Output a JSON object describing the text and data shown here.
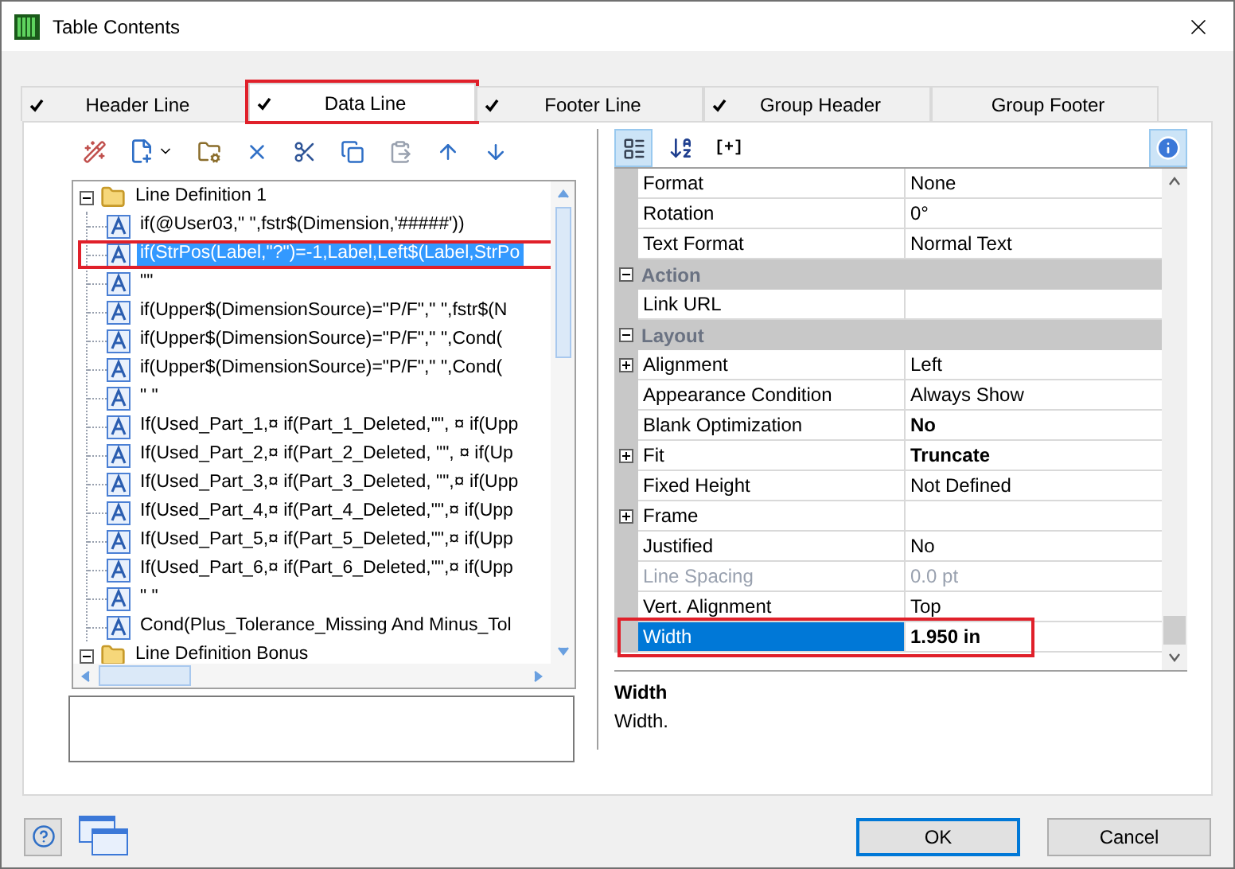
{
  "window": {
    "title": "Table Contents"
  },
  "tabs": [
    {
      "label": "Header Line",
      "checked": true,
      "selected": false,
      "highlighted": false
    },
    {
      "label": "Data Line",
      "checked": true,
      "selected": true,
      "highlighted": true
    },
    {
      "label": "Footer Line",
      "checked": true,
      "selected": false,
      "highlighted": false
    },
    {
      "label": "Group Header",
      "checked": true,
      "selected": false,
      "highlighted": false
    },
    {
      "label": "Group Footer",
      "checked": false,
      "selected": false,
      "highlighted": false
    }
  ],
  "left_toolbar": [
    {
      "kind": "wand",
      "disabled": false
    },
    {
      "kind": "new",
      "disabled": false
    },
    {
      "kind": "properties",
      "disabled": false
    },
    {
      "kind": "delete",
      "disabled": false
    },
    {
      "kind": "cut",
      "disabled": false
    },
    {
      "kind": "copy",
      "disabled": false
    },
    {
      "kind": "paste",
      "disabled": true
    },
    {
      "kind": "up",
      "disabled": false
    },
    {
      "kind": "down",
      "disabled": false
    }
  ],
  "tree": [
    {
      "label": "Line Definition  1",
      "expanded": true,
      "selected": false,
      "highlighted": false,
      "children": [
        {
          "label": "if(@User03,\" \",fstr$(Dimension,'#####'))",
          "selected": false,
          "highlighted": false
        },
        {
          "label": "if(StrPos(Label,\"?\")=-1,Label,Left$(Label,StrPo",
          "selected": true,
          "highlighted": true
        },
        {
          "label": "\"\"",
          "selected": false,
          "highlighted": false
        },
        {
          "label": "if(Upper$(DimensionSource)=\"P/F\",\" \",fstr$(N",
          "selected": false,
          "highlighted": false
        },
        {
          "label": "if(Upper$(DimensionSource)=\"P/F\",\" \",Cond(",
          "selected": false,
          "highlighted": false
        },
        {
          "label": "if(Upper$(DimensionSource)=\"P/F\",\" \",Cond(",
          "selected": false,
          "highlighted": false
        },
        {
          "label": "\" \"",
          "selected": false,
          "highlighted": false
        },
        {
          "label": "If(Used_Part_1,¤ if(Part_1_Deleted,\"\", ¤  if(Upp",
          "selected": false,
          "highlighted": false
        },
        {
          "label": "If(Used_Part_2,¤ if(Part_2_Deleted, \"\", ¤   if(Up",
          "selected": false,
          "highlighted": false
        },
        {
          "label": "If(Used_Part_3,¤ if(Part_3_Deleted, \"\",¤   if(Upp",
          "selected": false,
          "highlighted": false
        },
        {
          "label": "If(Used_Part_4,¤ if(Part_4_Deleted,\"\",¤   if(Upp",
          "selected": false,
          "highlighted": false
        },
        {
          "label": "If(Used_Part_5,¤ if(Part_5_Deleted,\"\",¤   if(Upp",
          "selected": false,
          "highlighted": false
        },
        {
          "label": "If(Used_Part_6,¤ if(Part_6_Deleted,\"\",¤   if(Upp",
          "selected": false,
          "highlighted": false
        },
        {
          "label": "\" \"",
          "selected": false,
          "highlighted": false
        },
        {
          "label": "Cond(Plus_Tolerance_Missing And Minus_Tol",
          "selected": false,
          "highlighted": false
        }
      ]
    },
    {
      "label": "Line Definition Bonus",
      "expanded": true,
      "selected": false,
      "highlighted": false
    }
  ],
  "right_toolbar": [
    {
      "kind": "categorized",
      "selected": true
    },
    {
      "kind": "sort",
      "selected": false
    },
    {
      "kind": "text",
      "label": "[+]",
      "selected": false
    },
    {
      "kind": "info",
      "selected": true
    }
  ],
  "properties": [
    {
      "kind": "property",
      "name": "Format",
      "value": "None",
      "expandable": false,
      "bold": false,
      "disabled": false,
      "selected": false,
      "highlighted": false
    },
    {
      "kind": "property",
      "name": "Rotation",
      "value": "0°",
      "expandable": false,
      "bold": false,
      "disabled": false,
      "selected": false,
      "highlighted": false
    },
    {
      "kind": "property",
      "name": "Text Format",
      "value": "Normal Text",
      "expandable": false,
      "bold": false,
      "disabled": false,
      "selected": false,
      "highlighted": false
    },
    {
      "kind": "category",
      "name": "Action",
      "expanded": true
    },
    {
      "kind": "property",
      "name": "Link URL",
      "expandable": false,
      "disabled": false,
      "selected": false,
      "highlighted": false
    },
    {
      "kind": "category",
      "name": "Layout",
      "expanded": true
    },
    {
      "kind": "property",
      "name": "Alignment",
      "value": "Left",
      "expandable": true,
      "bold": false,
      "disabled": false,
      "selected": false,
      "highlighted": false
    },
    {
      "kind": "property",
      "name": "Appearance Condition",
      "value": "Always Show",
      "expandable": false,
      "bold": false,
      "disabled": false,
      "selected": false,
      "highlighted": false
    },
    {
      "kind": "property",
      "name": "Blank Optimization",
      "value": "No",
      "expandable": false,
      "bold": true,
      "disabled": false,
      "selected": false,
      "highlighted": false
    },
    {
      "kind": "property",
      "name": "Fit",
      "value": "Truncate",
      "expandable": true,
      "bold": true,
      "disabled": false,
      "selected": false,
      "highlighted": false
    },
    {
      "kind": "property",
      "name": "Fixed Height",
      "value": "Not Defined",
      "expandable": false,
      "bold": false,
      "disabled": false,
      "selected": false,
      "highlighted": false
    },
    {
      "kind": "property",
      "name": "Frame",
      "expandable": true,
      "disabled": false,
      "selected": false,
      "highlighted": false
    },
    {
      "kind": "property",
      "name": "Justified",
      "value": "No",
      "expandable": false,
      "bold": false,
      "disabled": false,
      "selected": false,
      "highlighted": false
    },
    {
      "kind": "property",
      "name": "Line Spacing",
      "value": "0.0 pt",
      "expandable": false,
      "bold": false,
      "disabled": true,
      "selected": false,
      "highlighted": false
    },
    {
      "kind": "property",
      "name": "Vert. Alignment",
      "value": "Top",
      "expandable": false,
      "bold": false,
      "disabled": false,
      "selected": false,
      "highlighted": false
    },
    {
      "kind": "property",
      "name": "Width",
      "value": "1.950 in",
      "expandable": false,
      "bold": true,
      "disabled": false,
      "selected": true,
      "highlighted": true
    }
  ],
  "description": {
    "title": "Width",
    "text": "Width."
  },
  "buttons": [
    {
      "label": "OK",
      "default": true
    },
    {
      "label": "Cancel",
      "default": false
    }
  ]
}
